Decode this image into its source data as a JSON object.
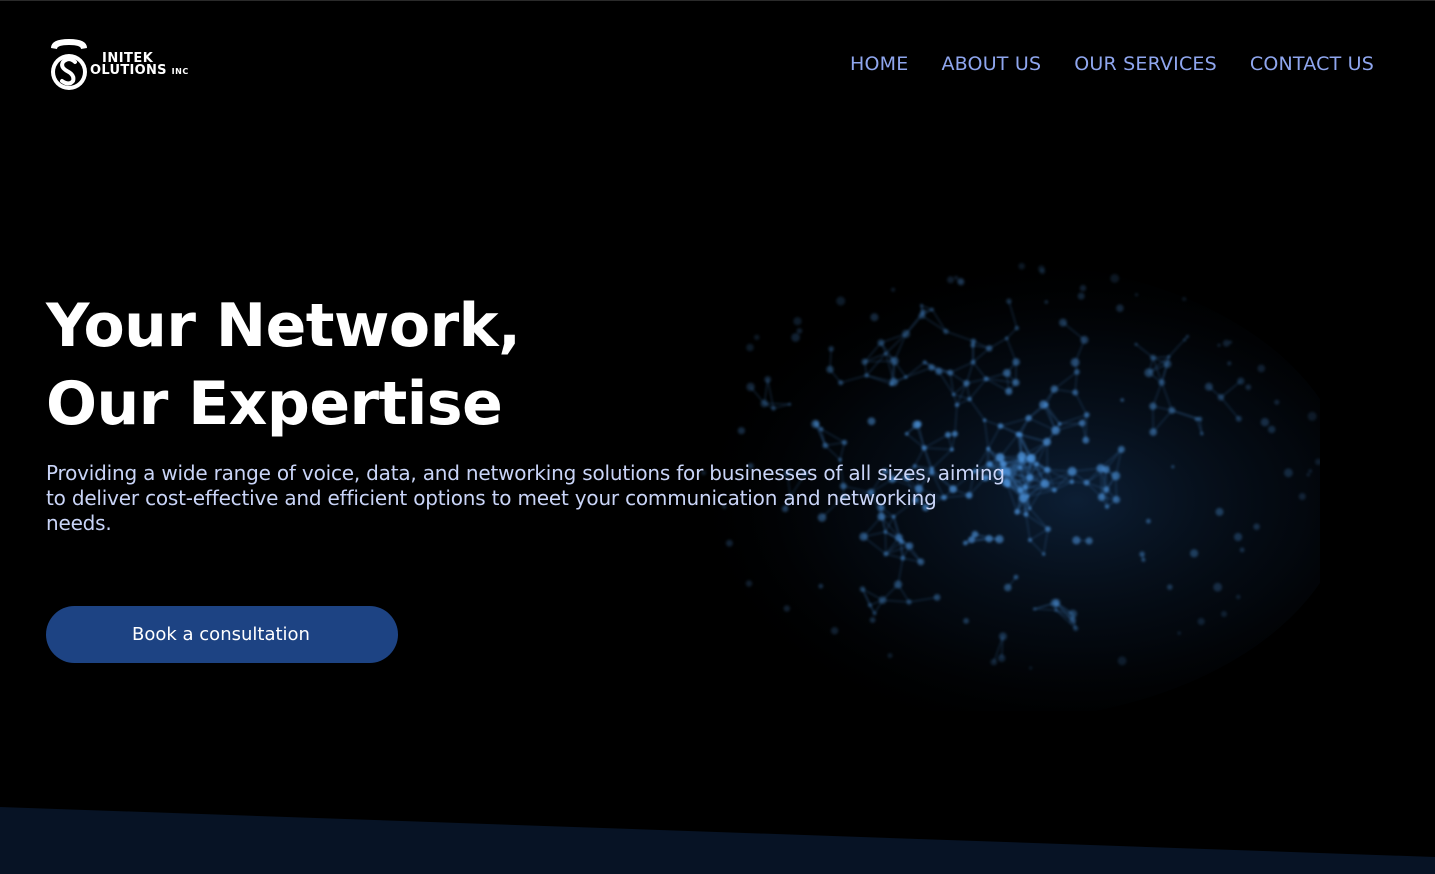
{
  "header": {
    "logo": {
      "line1": "INITEK",
      "line2_main": "OLUTIONS",
      "line2_suffix": "INC"
    },
    "nav": [
      {
        "label": "HOME"
      },
      {
        "label": "ABOUT US"
      },
      {
        "label": "OUR SERVICES"
      },
      {
        "label": "CONTACT US"
      }
    ]
  },
  "hero": {
    "title_line1": "Your Network,",
    "title_line2": "Our Expertise",
    "description": "Providing a wide range of voice, data, and networking solutions for businesses of all sizes, aiming to deliver cost-effective and efficient options to meet your communication and networking needs.",
    "cta_label": "Book a consultation"
  },
  "colors": {
    "background": "#000000",
    "nav_link": "#8fa6ee",
    "description_text": "#c9d4f7",
    "cta_background": "#1d4383",
    "bottom_band": "#071325",
    "particles": "#4a8fd6"
  }
}
